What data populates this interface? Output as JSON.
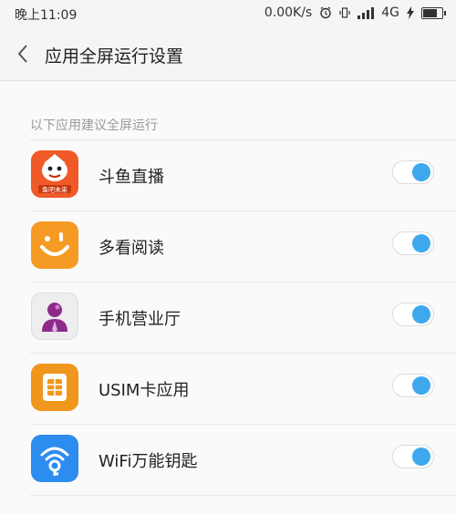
{
  "status_bar": {
    "time": "晚上11:09",
    "speed": "0.00K/s",
    "network": "4G",
    "battery_level": 0.85
  },
  "header": {
    "title": "应用全屏运行设置",
    "back_icon": "chevron-left-icon"
  },
  "section": {
    "label": "以下应用建议全屏运行"
  },
  "apps": [
    {
      "name": "斗鱼直播",
      "icon_text": "鱼吧未来",
      "enabled": true
    },
    {
      "name": "多看阅读",
      "enabled": true
    },
    {
      "name": "手机营业厅",
      "enabled": true
    },
    {
      "name": "USIM卡应用",
      "enabled": true
    },
    {
      "name": "WiFi万能钥匙",
      "enabled": true
    }
  ],
  "colors": {
    "toggle_on": "#3ea8ee",
    "douyu_bg": "#f05a28",
    "duokan_bg": "#f59b23",
    "yingye_bg": "#eeeeee",
    "usim_bg": "#f1961c",
    "wifi_bg": "#2d8cf0"
  }
}
